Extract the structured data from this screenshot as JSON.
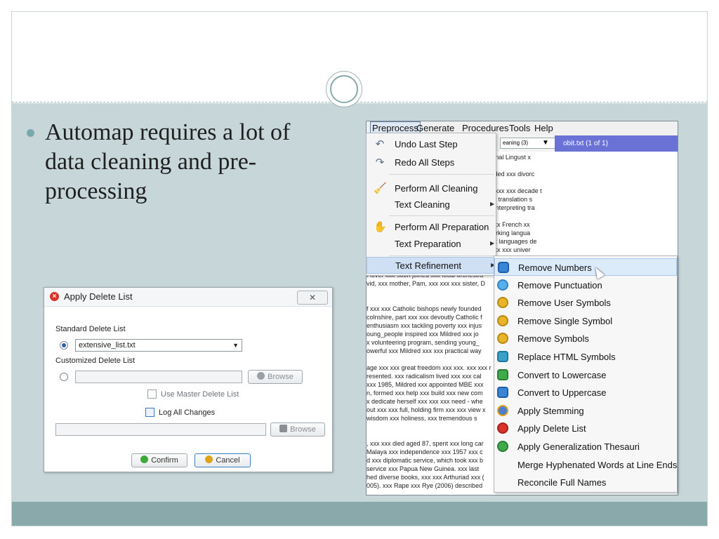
{
  "slide": {
    "bullet": "Automap requires a lot of data cleaning and pre-processing",
    "colors": {
      "content_bg": "#c7d6d8",
      "footer": "#8aa9ab",
      "bullet_dot": "#7aa9ad"
    }
  },
  "dialog": {
    "title": "Apply Delete List",
    "close_glyph": "✕",
    "standard_label": "Standard Delete List",
    "standard_value": "extensive_list.txt",
    "customized_label": "Customized Delete List",
    "browse_label": "Browse",
    "master_label": "Use Master Delete List",
    "log_label": "Log All Changes",
    "confirm_label": "Confirm",
    "cancel_label": "Cancel"
  },
  "app": {
    "menu": [
      "Preprocess",
      "Generate",
      "Procedures",
      "Tools",
      "Help"
    ],
    "toolbar_select": "eaning (3)",
    "file_label": "obit.txt   (1 of 1)",
    "text_lines": [
      "r.  This drew xxx xxx working xxx xxx international Lingust x",
      "",
      "annah, xxx xxx marriage xxx Eileen, which ended xxx divorc",
      "",
      "our, xxx xxx translator xxx interpreter, xxx xxx xxx xxx decade t",
      "xxx MA course xxx conference interpreting xxx translation s",
      "institutions xxx xxx center xxx excellence xxx interpreting tra",
      "er students regarded xxx xxx xxx role model.",
      "ttended Allerton high_school. xxx graduated xxx French xx",
      "ssels, having added Italian as_one xxx xxx working langua",
      "sity, xxx xxx appointed xxx xxx lecturer xxx xxx languages de",
      "xternal examiner xxx language departments xxx xxx univer",
      "",
      "",
      "t lover xxx soon joined xxx local orchestra",
      "vid, xxx mother, Pam, xxx xxx xxx sister, D",
      "",
      "",
      "f xxx xxx Catholic bishops newly founded",
      "colnshire, part xxx xxx devoutly Catholic f",
      "enthusiasm xxx tackling poverty xxx injus",
      "oung_people inspired xxx Mildred xxx jo",
      "x volunteering program, sending young_",
      "owerful xxx Mildred xxx xxx practical way",
      "",
      "age xxx xxx great freedom xxx xxx. xxx xxx r",
      "resented. xxx radicalism lived xxx xxx cal",
      " xxx 1985, Mildred xxx appointed MBE xxx",
      "n, formed xxx help xxx build xxx new com",
      "x dedicate herself xxx xxx xxx need - whe",
      "out xxx xxx full, holding firm xxx xxx view x",
      "wisdom xxx holiness, xxx tremendous s",
      "",
      "",
      ", xxx xxx died aged 87, spent xxx long car",
      "Malaya xxx independence xxx 1957 xxx c",
      "d xxx diplomatic service, which took xxx b",
      "service xxx Papua New Guinea. xxx last",
      "hed diverse books, xxx xxx Arthuriad xxx (",
      "005). xxx Rape xxx Rye (2006) described"
    ]
  },
  "menu_preprocess": {
    "undo": "Undo Last Step",
    "redo": "Redo All Steps",
    "perform_cleaning": "Perform All Cleaning",
    "text_cleaning": "Text Cleaning",
    "perform_preparation": "Perform All Preparation",
    "text_preparation": "Text Preparation",
    "text_refinement": "Text Refinement"
  },
  "menu_refinement": {
    "items": [
      "Remove Numbers",
      "Remove Punctuation",
      "Remove User Symbols",
      "Remove Single Symbol",
      "Remove Symbols",
      "Replace HTML Symbols",
      "Convert to Lowercase",
      "Convert to Uppercase",
      "Apply Stemming",
      "Apply Delete List",
      "Apply Generalization Thesauri",
      "Merge Hyphenated Words at Line Ends",
      "Reconcile Full Names"
    ]
  }
}
